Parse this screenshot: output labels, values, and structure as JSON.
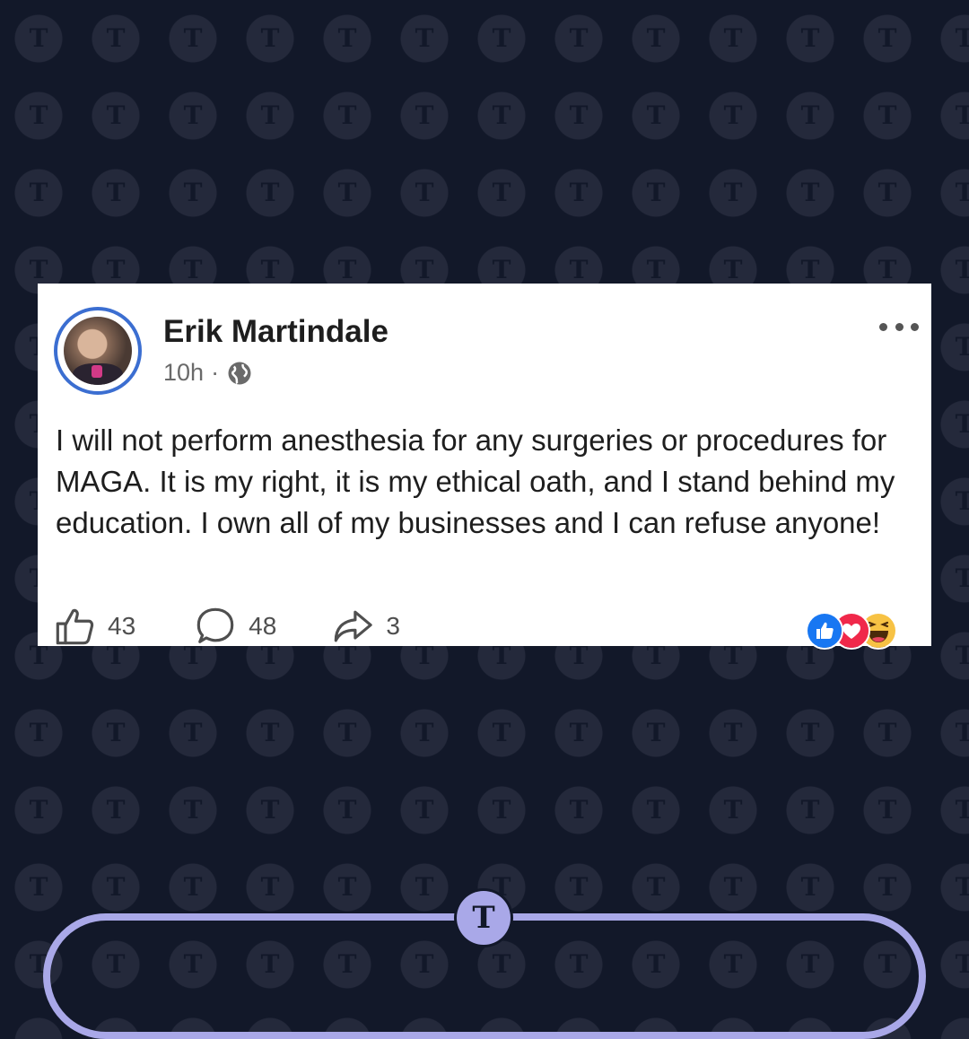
{
  "watermark": {
    "glyph": "T"
  },
  "post": {
    "author": "Erik Martindale",
    "time": "10h",
    "separator": "·",
    "privacy_icon": "globe-icon",
    "menu_icon": "more-options-icon",
    "text": "I will not perform anesthesia for any surgeries or procedures for MAGA. It is my right, it is my ethical oath, and I stand behind my education. I own all of my businesses and I can refuse anyone!",
    "likes": "43",
    "comments": "48",
    "shares": "3",
    "reactions": [
      "like-reaction-icon",
      "love-reaction-icon",
      "haha-reaction-icon"
    ]
  },
  "brand": {
    "badge_glyph": "T"
  },
  "colors": {
    "background": "#121829",
    "pattern_circle": "#24293b",
    "accent": "#a9a8e8",
    "avatar_ring": "#3b6ed1",
    "like_blue": "#1877f2",
    "love_red": "#f0284a",
    "haha_yellow": "#f7c244"
  }
}
